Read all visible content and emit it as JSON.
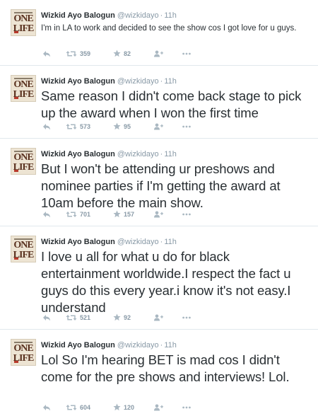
{
  "tweets": [
    {
      "name": "Wizkid Ayo Balogun",
      "handle": "@wizkidayo",
      "dot": "·",
      "time": "11h",
      "text": "I'm in LA to work and decided to see the show cos I got love for u guys.",
      "size": "small",
      "retweets": "359",
      "favorites": "82"
    },
    {
      "name": "Wizkid Ayo Balogun",
      "handle": "@wizkidayo",
      "dot": "·",
      "time": "11h",
      "text": "Same reason I didn't come back stage to pick up the award when I won the first time",
      "size": "large",
      "retweets": "573",
      "favorites": "95"
    },
    {
      "name": "Wizkid Ayo Balogun",
      "handle": "@wizkidayo",
      "dot": "·",
      "time": "11h",
      "text": "But I won't be attending ur preshows and nominee parties if I'm getting the award at 10am before the main show.",
      "size": "large",
      "retweets": "701",
      "favorites": "157"
    },
    {
      "name": "Wizkid Ayo Balogun",
      "handle": "@wizkidayo",
      "dot": "·",
      "time": "11h",
      "text": "I love u all for what u do for black entertainment  worldwide.I respect the fact u guys do this every year.i know it's not easy.I understand",
      "size": "large",
      "retweets": "521",
      "favorites": "92"
    },
    {
      "name": "Wizkid Ayo Balogun",
      "handle": "@wizkidayo",
      "dot": "·",
      "time": "11h",
      "text": "Lol So I'm hearing BET is mad cos I didn't come for the pre shows and interviews! Lol.",
      "size": "large",
      "retweets": "604",
      "favorites": "120"
    }
  ],
  "icons": {
    "reply": "reply-icon",
    "retweet": "retweet-icon",
    "favorite": "star-icon",
    "follow": "follow-icon",
    "more": "more-icon"
  },
  "colors": {
    "name": "#292f33",
    "meta": "#8899a6",
    "divider": "#e1e8ed"
  }
}
